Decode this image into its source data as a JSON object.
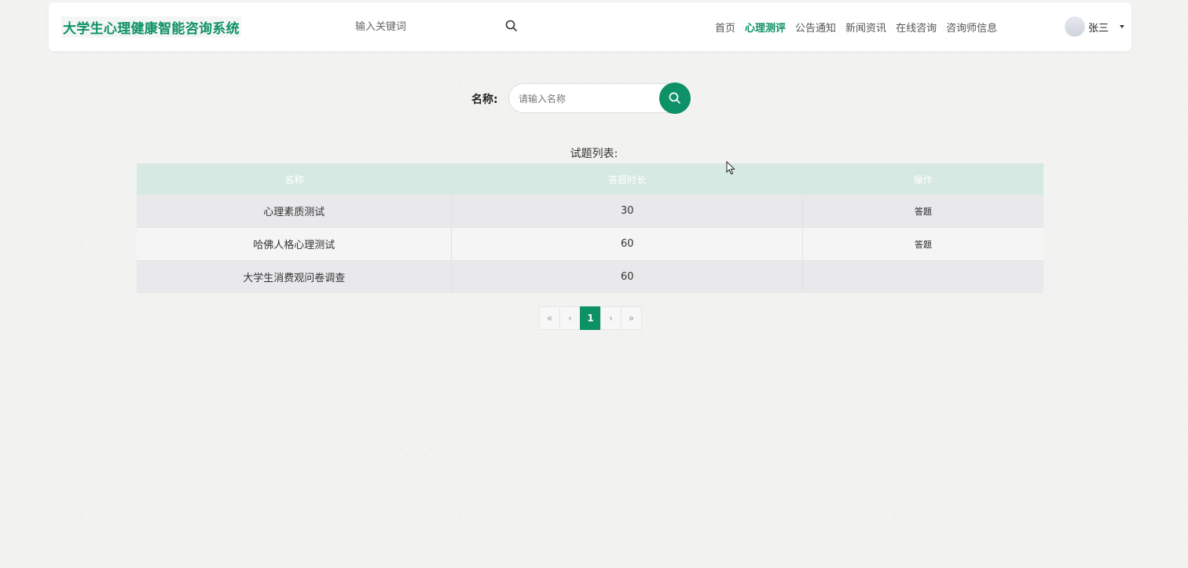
{
  "header": {
    "logo": "大学生心理健康智能咨询系统",
    "search_placeholder": "输入关键词",
    "nav": [
      "首页",
      "心理测评",
      "公告通知",
      "新闻资讯",
      "在线咨询",
      "咨询师信息"
    ],
    "active_nav": "心理测评",
    "user_name": "张三"
  },
  "search": {
    "label": "名称:",
    "placeholder": "请输入名称"
  },
  "list": {
    "title": "试题列表:",
    "columns": [
      "名称",
      "答题时长",
      "操作"
    ],
    "rows": [
      {
        "name": "心理素质测试",
        "duration": "30",
        "action": "答题"
      },
      {
        "name": "哈佛人格心理测试",
        "duration": "60",
        "action": "答题"
      },
      {
        "name": "大学生消费观问卷调查",
        "duration": "60",
        "action": ""
      }
    ]
  },
  "pagination": {
    "first": "«",
    "prev": "‹",
    "current": "1",
    "next": "›",
    "last": "»"
  },
  "colors": {
    "accent": "#0e9166",
    "table_header": "#d6e9e2"
  }
}
